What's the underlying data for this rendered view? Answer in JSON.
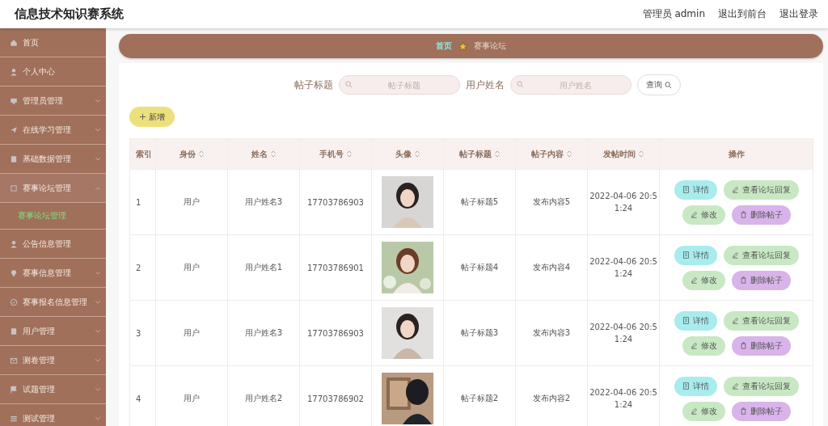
{
  "header": {
    "title": "信息技术知识赛系统",
    "links": [
      "管理员 admin",
      "退出到前台",
      "退出登录"
    ]
  },
  "sidebar": {
    "items": [
      {
        "label": "首页",
        "kind": "link"
      },
      {
        "label": "个人中心",
        "kind": "link"
      },
      {
        "label": "管理员管理",
        "kind": "menu",
        "expanded": false
      },
      {
        "label": "在线学习管理",
        "kind": "menu",
        "expanded": false
      },
      {
        "label": "基础数据管理",
        "kind": "menu",
        "expanded": false
      },
      {
        "label": "赛事论坛管理",
        "kind": "menu",
        "expanded": true,
        "children": [
          {
            "label": "赛事论坛管理",
            "selected": true
          }
        ]
      },
      {
        "label": "公告信息管理",
        "kind": "link"
      },
      {
        "label": "赛事信息管理",
        "kind": "menu",
        "expanded": false
      },
      {
        "label": "赛事报名信息管理",
        "kind": "menu",
        "expanded": false
      },
      {
        "label": "用户管理",
        "kind": "menu",
        "expanded": false
      },
      {
        "label": "测卷管理",
        "kind": "menu",
        "expanded": false
      },
      {
        "label": "试题管理",
        "kind": "menu",
        "expanded": false
      },
      {
        "label": "测试管理",
        "kind": "menu",
        "expanded": false
      }
    ]
  },
  "breadcrumb": [
    "首页",
    "赛事论坛"
  ],
  "search": {
    "fields": [
      {
        "label": "帖子标题",
        "placeholder": "帖子标题"
      },
      {
        "label": "用户姓名",
        "placeholder": "用户姓名"
      }
    ],
    "button": "查询"
  },
  "add_button": "新增",
  "table": {
    "columns": [
      {
        "label": "索引",
        "sortable": false
      },
      {
        "label": "身份",
        "sortable": true
      },
      {
        "label": "姓名",
        "sortable": true
      },
      {
        "label": "手机号",
        "sortable": true
      },
      {
        "label": "头像",
        "sortable": true
      },
      {
        "label": "帖子标题",
        "sortable": true
      },
      {
        "label": "帖子内容",
        "sortable": true
      },
      {
        "label": "发帖时间",
        "sortable": true
      },
      {
        "label": "操作",
        "sortable": false
      }
    ],
    "rows": [
      {
        "index": "1",
        "role": "用户",
        "name": "用户姓名3",
        "phone": "17703786903",
        "title": "帖子标题5",
        "content": "发布内容5",
        "time": "2022-04-06 20:51:24",
        "actions": [
          {
            "label": "详情",
            "kind": "detail"
          },
          {
            "label": "查看论坛回复",
            "kind": "reply"
          },
          {
            "label": "修改",
            "kind": "edit"
          },
          {
            "label": "删除帖子",
            "kind": "delete"
          }
        ]
      },
      {
        "index": "2",
        "role": "用户",
        "name": "用户姓名1",
        "phone": "17703786901",
        "title": "帖子标题4",
        "content": "发布内容4",
        "time": "2022-04-06 20:51:24",
        "actions": [
          {
            "label": "详情",
            "kind": "detail"
          },
          {
            "label": "查看论坛回复",
            "kind": "reply"
          },
          {
            "label": "修改",
            "kind": "edit"
          },
          {
            "label": "删除帖子",
            "kind": "delete"
          }
        ]
      },
      {
        "index": "3",
        "role": "用户",
        "name": "用户姓名3",
        "phone": "17703786903",
        "title": "帖子标题3",
        "content": "发布内容3",
        "time": "2022-04-06 20:51:24",
        "actions": [
          {
            "label": "详情",
            "kind": "detail"
          },
          {
            "label": "查看论坛回复",
            "kind": "reply"
          },
          {
            "label": "修改",
            "kind": "edit"
          },
          {
            "label": "删除帖子",
            "kind": "delete"
          }
        ]
      },
      {
        "index": "4",
        "role": "用户",
        "name": "用户姓名2",
        "phone": "17703786902",
        "title": "帖子标题2",
        "content": "发布内容2",
        "time": "2022-04-06 20:51:24",
        "actions": [
          {
            "label": "详情",
            "kind": "detail"
          },
          {
            "label": "查看论坛回复",
            "kind": "reply"
          },
          {
            "label": "修改",
            "kind": "edit"
          },
          {
            "label": "删除帖子",
            "kind": "delete"
          }
        ]
      }
    ]
  }
}
